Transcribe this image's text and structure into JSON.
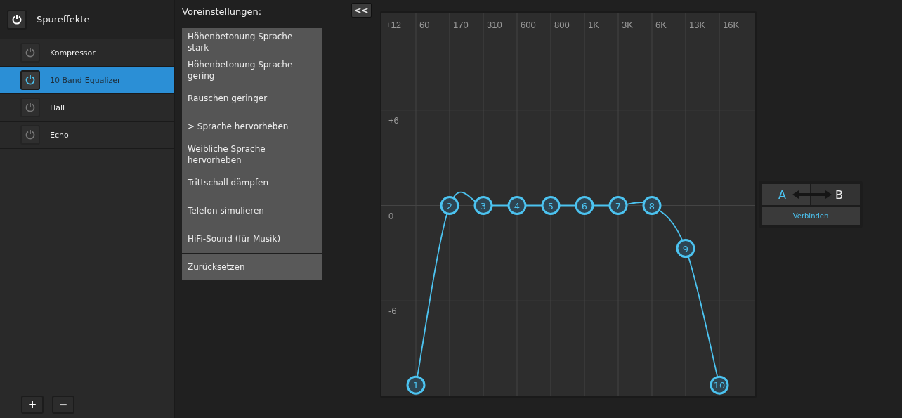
{
  "sidebar": {
    "title": "Spureffekte",
    "items": [
      {
        "label": "Kompressor",
        "on": false,
        "selected": false
      },
      {
        "label": "10-Band-Equalizer",
        "on": true,
        "selected": true
      },
      {
        "label": "Hall",
        "on": false,
        "selected": false
      },
      {
        "label": "Echo",
        "on": false,
        "selected": false
      }
    ],
    "add_button": "+",
    "remove_button": "−"
  },
  "presets": {
    "title": "Voreinstellungen:",
    "collapse_button": "<<",
    "items": [
      "Höhenbetonung Sprache stark",
      "Höhenbetonung Sprache gering",
      "Rauschen geringer",
      "> Sprache hervorheben",
      "Weibliche Sprache hervorheben",
      "Trittschall dämpfen",
      "Telefon simulieren",
      "HiFi-Sound (für Musik)"
    ],
    "reset": "Zurücksetzen"
  },
  "equalizer": {
    "chart_data": {
      "type": "line",
      "categories": [
        "60",
        "170",
        "310",
        "600",
        "800",
        "1K",
        "3K",
        "6K",
        "13K",
        "16K"
      ],
      "ylim": [
        -12,
        12
      ],
      "yticks": [
        {
          "value": 12,
          "label": "+12"
        },
        {
          "value": 6,
          "label": "+6"
        },
        {
          "value": 0,
          "label": "0"
        },
        {
          "value": -6,
          "label": "-6"
        }
      ],
      "grid": true,
      "series": [
        {
          "marker": "circle",
          "color": "#4cc3f0",
          "values": [
            -11.3,
            0,
            0,
            0,
            0,
            0,
            0,
            0,
            -2.7,
            -11.3
          ]
        }
      ],
      "value_labels": [
        "1",
        "2",
        "3",
        "4",
        "5",
        "6",
        "7",
        "8",
        "9",
        "10"
      ]
    }
  },
  "ab": {
    "a": "A",
    "b": "B",
    "connect": "Verbinden"
  }
}
